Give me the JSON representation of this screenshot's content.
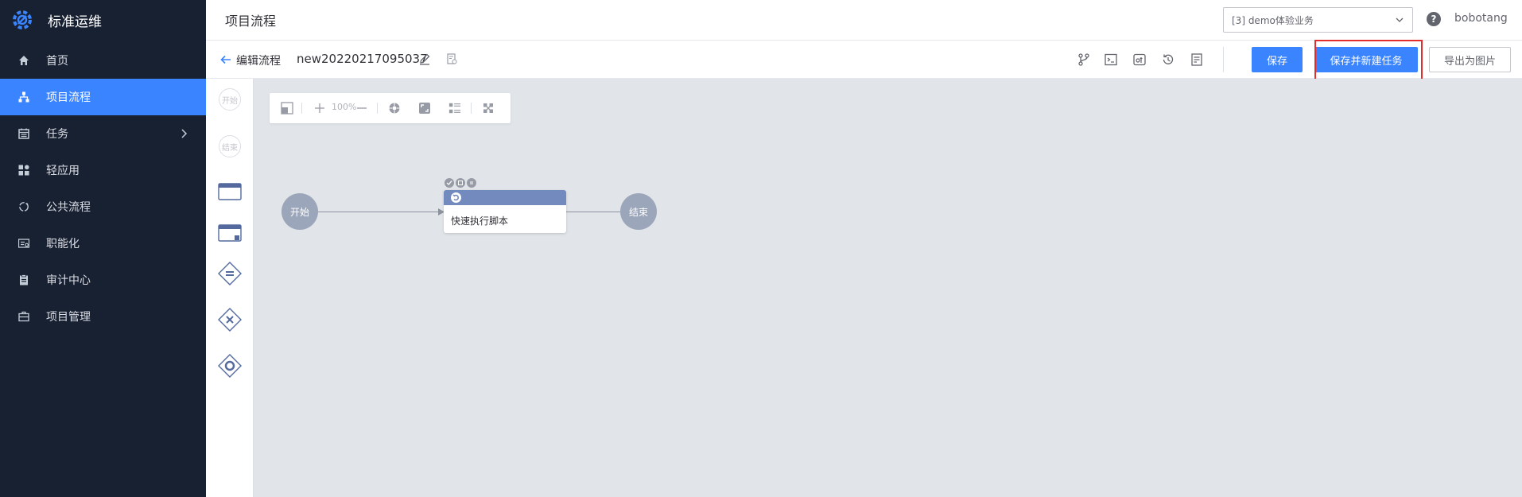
{
  "brand": {
    "name": "标准运维",
    "logo_icon": "gear-logo-icon"
  },
  "sidebar": {
    "items": [
      {
        "label": "首页",
        "icon": "home-icon",
        "active": false
      },
      {
        "label": "项目流程",
        "icon": "hierarchy-icon",
        "active": true
      },
      {
        "label": "任务",
        "icon": "calendar-icon",
        "active": false,
        "has_children": true
      },
      {
        "label": "轻应用",
        "icon": "apps-icon",
        "active": false
      },
      {
        "label": "公共流程",
        "icon": "cycle-icon",
        "active": false
      },
      {
        "label": "职能化",
        "icon": "id-card-icon",
        "active": false
      },
      {
        "label": "审计中心",
        "icon": "clipboard-icon",
        "active": false
      },
      {
        "label": "项目管理",
        "icon": "briefcase-icon",
        "active": false
      }
    ]
  },
  "header": {
    "title": "项目流程",
    "business_select": "[3] demo体验业务",
    "help": "?",
    "username": "bobotang"
  },
  "toolbar": {
    "back_label": "编辑流程",
    "flow_name": "new20220217095037",
    "save_label": "保存",
    "save_new_task_label": "保存并新建任务",
    "export_label": "导出为图片"
  },
  "palette": {
    "start_label": "开始",
    "end_label": "结束"
  },
  "canvas_tools": {
    "zoom": "100%"
  },
  "flow": {
    "start_label": "开始",
    "end_label": "结束",
    "task_label": "快速执行脚本"
  },
  "colors": {
    "sidebar_bg": "#182132",
    "accent": "#3a84ff",
    "highlight": "#e22d2d",
    "canvas_bg": "#e1e4e8",
    "node_gray": "#9ba6ba",
    "task_header": "#738abe"
  }
}
